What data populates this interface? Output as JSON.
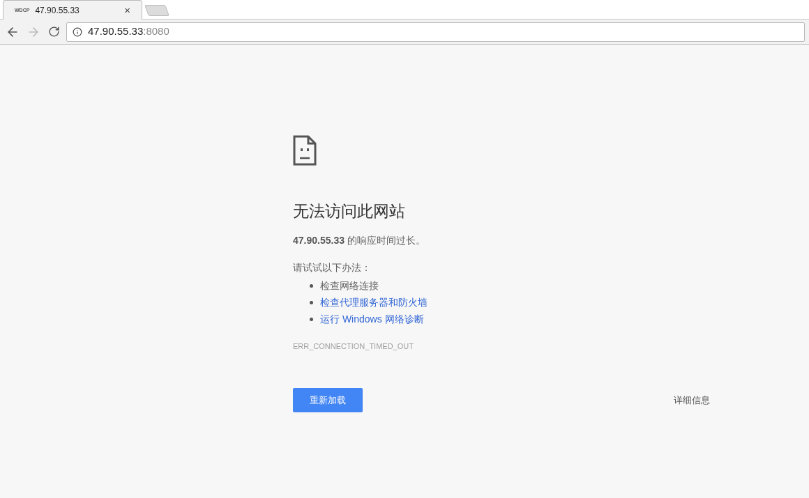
{
  "tabs": [
    {
      "favicon_text": "WDCP",
      "title": "47.90.55.33",
      "close": "×",
      "selected": true
    }
  ],
  "address_bar": {
    "host": "47.90.55.33",
    "port": ":8080"
  },
  "error": {
    "title": "无法访问此网站",
    "message": "**47.90.55.33** 的响应时间过长。",
    "suggestions_heading": "请试试以下办法：",
    "suggestions": [
      {
        "kind": "text",
        "text": "检查网络连接"
      },
      {
        "kind": "link",
        "text": "检查代理服务器和防火墙"
      },
      {
        "kind": "link",
        "text": "运行 Windows 网络诊断"
      }
    ],
    "code": "ERR_CONNECTION_TIMED_OUT",
    "reload_button": "重新加载",
    "details_button": "详细信息"
  }
}
